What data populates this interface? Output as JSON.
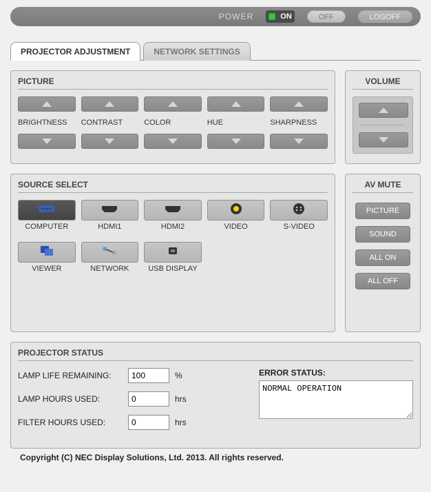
{
  "topbar": {
    "power_label": "POWER",
    "on_label": "ON",
    "off_label": "OFF",
    "logoff_label": "LOGOFF"
  },
  "tabs": {
    "projector_adjustment": "PROJECTOR ADJUSTMENT",
    "network_settings": "NETWORK SETTINGS"
  },
  "picture": {
    "title": "PICTURE",
    "items": [
      "BRIGHTNESS",
      "CONTRAST",
      "COLOR",
      "HUE",
      "SHARPNESS"
    ]
  },
  "volume": {
    "title": "VOLUME"
  },
  "source": {
    "title": "SOURCE SELECT",
    "items": [
      "COMPUTER",
      "HDMI1",
      "HDMI2",
      "VIDEO",
      "S-VIDEO",
      "VIEWER",
      "NETWORK",
      "USB DISPLAY"
    ],
    "active": "COMPUTER"
  },
  "avmute": {
    "title": "AV MUTE",
    "picture": "PICTURE",
    "sound": "SOUND",
    "all_on": "ALL ON",
    "all_off": "ALL OFF"
  },
  "status": {
    "title": "PROJECTOR STATUS",
    "lamp_life_label": "LAMP LIFE REMAINING:",
    "lamp_life_value": "100",
    "lamp_life_unit": "%",
    "lamp_hours_label": "LAMP HOURS USED:",
    "lamp_hours_value": "0",
    "lamp_hours_unit": "hrs",
    "filter_hours_label": "FILTER HOURS USED:",
    "filter_hours_value": "0",
    "filter_hours_unit": "hrs",
    "error_label": "ERROR STATUS:",
    "error_value": "NORMAL OPERATION"
  },
  "copyright": "Copyright (C) NEC Display Solutions, Ltd. 2013. All rights reserved."
}
